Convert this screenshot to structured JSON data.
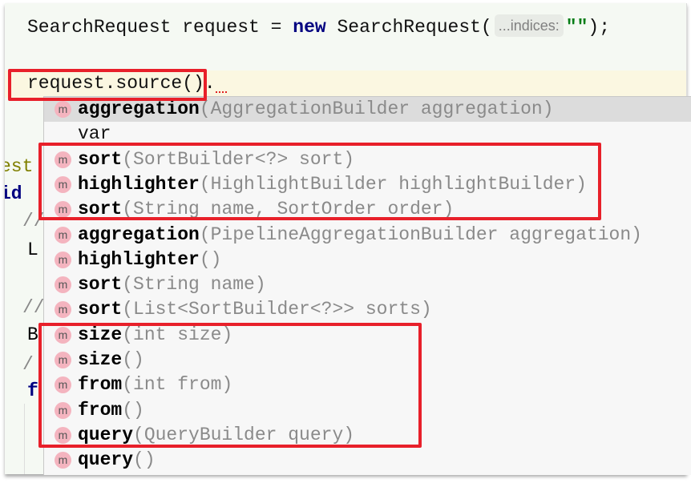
{
  "editor": {
    "line1": {
      "type": "SearchRequest",
      "var": " request = ",
      "keyword": "new",
      "ctor": " SearchRequest(",
      "hint": "...indices:",
      "string": "\"\"",
      "end": ");"
    },
    "line2": {
      "text": "request.source()",
      "dot": "."
    },
    "gutter_fragments": [
      "est",
      "id",
      "//",
      "L",
      "//",
      "B",
      "/",
      "f"
    ]
  },
  "completion": {
    "icon": "method-icon",
    "icon_letter": "m",
    "items": [
      {
        "name": "aggregation",
        "params": "(AggregationBuilder aggregation)",
        "selected": true
      },
      {
        "name": "var",
        "params": "",
        "icon": false
      },
      {
        "name": "sort",
        "params": "(SortBuilder<?> sort)"
      },
      {
        "name": "highlighter",
        "params": "(HighlightBuilder highlightBuilder)"
      },
      {
        "name": "sort",
        "params": "(String name, SortOrder order)"
      },
      {
        "name": "aggregation",
        "params": "(PipelineAggregationBuilder aggregation)"
      },
      {
        "name": "highlighter",
        "params": "()"
      },
      {
        "name": "sort",
        "params": "(String name)"
      },
      {
        "name": "sort",
        "params": "(List<SortBuilder<?>> sorts)"
      },
      {
        "name": "size",
        "params": "(int size)"
      },
      {
        "name": "size",
        "params": "()"
      },
      {
        "name": "from",
        "params": "(int from)"
      },
      {
        "name": "from",
        "params": "()"
      },
      {
        "name": "query",
        "params": "(QueryBuilder query)"
      },
      {
        "name": "query",
        "params": "()"
      }
    ]
  },
  "colors": {
    "annotation": "#e8202a",
    "method_icon": "#f4b4bf",
    "keyword": "#000080",
    "string": "#067d17"
  }
}
